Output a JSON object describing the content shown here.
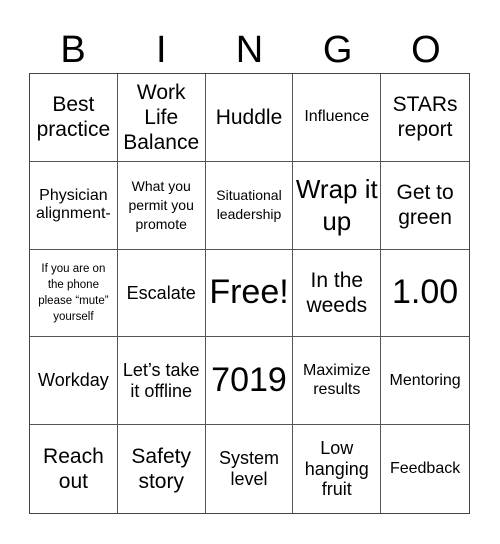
{
  "header": {
    "letters": [
      "B",
      "I",
      "N",
      "G",
      "O"
    ]
  },
  "cells": [
    "Best practice",
    "Work Life Balance",
    "Huddle",
    "Influence",
    "STARs report",
    "Physician alignment-",
    "What you permit you promote",
    "Situational leadership",
    "Wrap it up",
    "Get to green",
    "If you are on the phone please “mute” yourself",
    "Escalate",
    "Free!",
    "In the weeds",
    "1.00",
    "Workday",
    "Let’s take it offline",
    "7019",
    "Maximize results",
    "Mentoring",
    "Reach out",
    "Safety story",
    "System level",
    "Low hanging fruit",
    "Feedback"
  ]
}
